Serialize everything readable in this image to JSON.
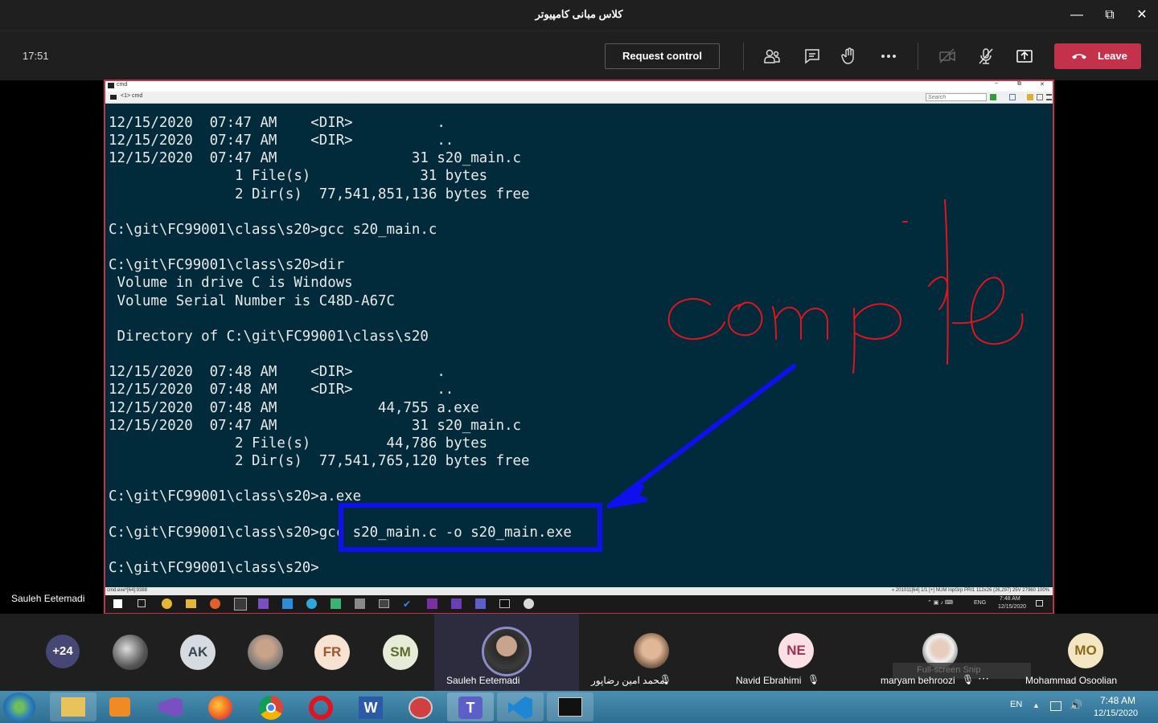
{
  "window": {
    "title": "کلاس مبانی کامپیوتر"
  },
  "toolbar": {
    "clock": "17:51",
    "request_control": "Request control",
    "leave": "Leave"
  },
  "share": {
    "cmd_title": "cmd",
    "cmd_tab": "<1> cmd",
    "search_placeholder": "Search",
    "console_text": "12/15/2020  07:47 AM    <DIR>          .\n12/15/2020  07:47 AM    <DIR>          ..\n12/15/2020  07:47 AM                31 s20_main.c\n               1 File(s)             31 bytes\n               2 Dir(s)  77,541,851,136 bytes free\n\nC:\\git\\FC99001\\class\\s20>gcc s20_main.c\n\nC:\\git\\FC99001\\class\\s20>dir\n Volume in drive C is Windows\n Volume Serial Number is C48D-A67C\n\n Directory of C:\\git\\FC99001\\class\\s20\n\n12/15/2020  07:48 AM    <DIR>          .\n12/15/2020  07:48 AM    <DIR>          ..\n12/15/2020  07:48 AM            44,755 a.exe\n12/15/2020  07:47 AM                31 s20_main.c\n               2 File(s)         44,786 bytes\n               2 Dir(s)  77,541,765,120 bytes free\n\nC:\\git\\FC99001\\class\\s20>a.exe\n\nC:\\git\\FC99001\\class\\s20>gcc s20_main.c -o s20_main.exe\n\nC:\\git\\FC99001\\class\\s20>",
    "annotation_word": "compile",
    "status_left": "cmd.exe*[64]:9388",
    "status_right": "« 201011[64]  1/1  [+] NUM  InpGrp  PRI1   112x26   (26,297) 25V    27960 100%",
    "inner_time": "7:48 AM",
    "inner_date": "12/15/2020",
    "inner_lang": "ENG"
  },
  "presenter_label": "Sauleh Eetemadi",
  "participants": {
    "overflow": "+24",
    "avatars": [
      {
        "initials": "AK"
      },
      {
        "initials": "FR"
      },
      {
        "initials": "SM"
      }
    ],
    "tiles": [
      {
        "name": "Sauleh Eetemadi"
      },
      {
        "name": "محمد امین رضاپور"
      },
      {
        "initials": "NE",
        "name": "Navid Ebrahimi"
      },
      {
        "name": "maryam behroozi"
      },
      {
        "initials": "MO",
        "name": "Mohammad Osoolian"
      }
    ],
    "snip_tooltip": "Full-screen Snip"
  },
  "taskbar": {
    "lang": "EN",
    "time": "7:48 AM",
    "date": "12/15/2020"
  },
  "colors": {
    "leave": "#c4314b",
    "console_bg": "#012b3b",
    "ink_red": "#e0141e",
    "ink_blue": "#1010ee"
  }
}
